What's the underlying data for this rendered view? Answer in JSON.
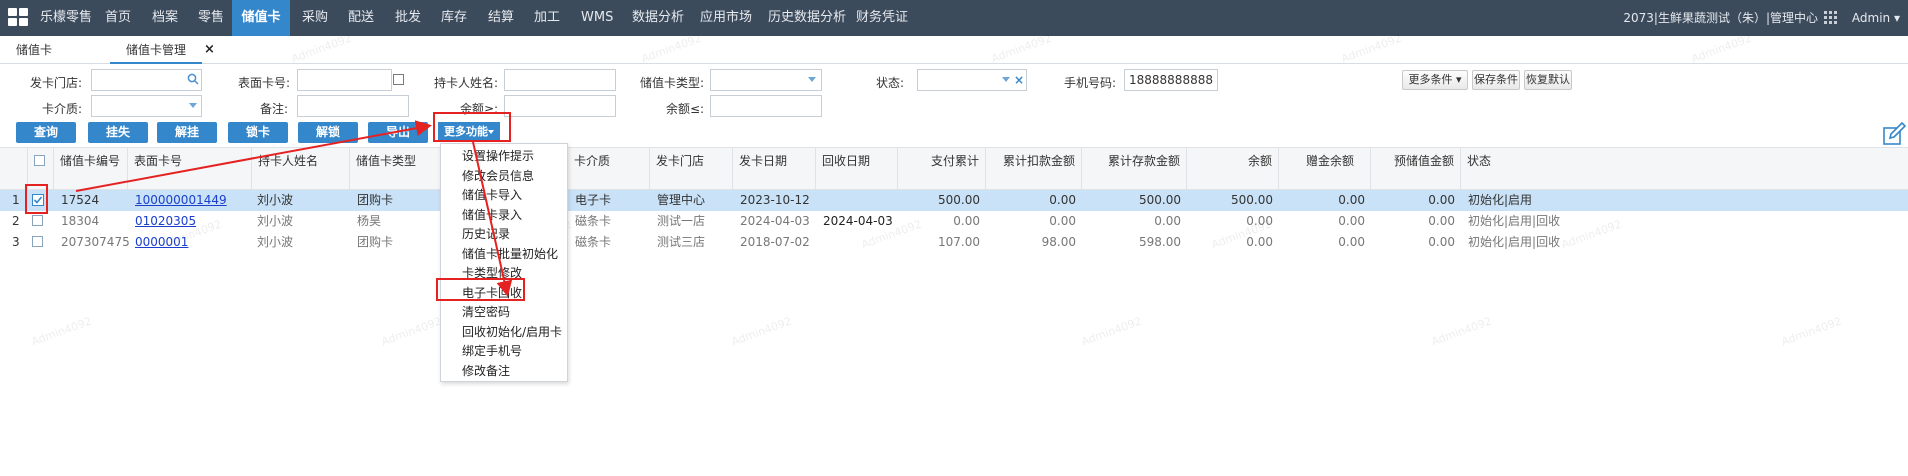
{
  "nav": {
    "brand": "乐檬零售",
    "items": [
      "首页",
      "档案",
      "零售",
      "储值卡",
      "采购",
      "配送",
      "批发",
      "库存",
      "结算",
      "加工",
      "WMS",
      "数据分析",
      "应用市场",
      "历史数据分析",
      "财务凭证"
    ],
    "active": "储值卡",
    "store_info": "2073|生鲜果蔬测试（朱）|管理中心",
    "user": "Admin"
  },
  "tabs": [
    "储值卡",
    "储值卡管理"
  ],
  "tab_close": "×",
  "form": {
    "issue_store_label": "发卡门店:",
    "face_card_no_label": "表面卡号:",
    "holder_name_label": "持卡人姓名:",
    "card_type_label": "储值卡类型:",
    "status_label": "状态:",
    "status_clear": "×",
    "phone_label": "手机号码:",
    "phone_value": "18888888888",
    "medium_label": "卡介质:",
    "remark_label": "备注:",
    "balance_ge_label": "余额≥:",
    "balance_le_label": "余额≤:",
    "more_conditions": "更多条件",
    "save_conditions": "保存条件",
    "restore_default": "恢复默认"
  },
  "buttons": {
    "query": "查询",
    "report_loss": "挂失",
    "cancel_loss": "解挂",
    "lock": "锁卡",
    "unlock": "解锁",
    "export": "导出",
    "more_functions": "更多功能"
  },
  "table": {
    "columns": [
      "储值卡编号",
      "表面卡号",
      "持卡人姓名",
      "储值卡类型",
      "卡介质",
      "发卡门店",
      "发卡日期",
      "回收日期",
      "支付累计",
      "累计扣款金额",
      "累计存款金额",
      "余额",
      "赠金余额",
      "预储值金额",
      "状态"
    ],
    "rows": [
      {
        "num": "1",
        "id": "17524",
        "face": "100000001449",
        "holder": "刘小波",
        "type": "团购卡",
        "medium": "电子卡",
        "store": "管理中心",
        "issue_date": "2023-10-12",
        "recycle_date": "",
        "pay_total": "500.00",
        "deduct_total": "0.00",
        "deposit_total": "500.00",
        "balance": "500.00",
        "gift_balance": "0.00",
        "prestore": "0.00",
        "status": "初始化|启用"
      },
      {
        "num": "2",
        "id": "18304",
        "face": "01020305",
        "holder": "刘小波",
        "type": "杨昊",
        "medium": "磁条卡",
        "store": "测试一店",
        "issue_date": "2024-04-03",
        "recycle_date": "2024-04-03",
        "pay_total": "0.00",
        "deduct_total": "0.00",
        "deposit_total": "0.00",
        "balance": "0.00",
        "gift_balance": "0.00",
        "prestore": "0.00",
        "status": "初始化|启用|回收"
      },
      {
        "num": "3",
        "id": "207307475",
        "face": "0000001",
        "holder": "刘小波",
        "type": "团购卡",
        "medium": "磁条卡",
        "store": "测试三店",
        "issue_date": "2018-07-02",
        "recycle_date": "",
        "pay_total": "107.00",
        "deduct_total": "98.00",
        "deposit_total": "598.00",
        "balance": "0.00",
        "gift_balance": "0.00",
        "prestore": "0.00",
        "status": "初始化|启用|回收"
      }
    ]
  },
  "menu": [
    "设置操作提示",
    "修改会员信息",
    "储值卡导入",
    "储值卡录入",
    "历史记录",
    "储值卡批量初始化",
    "卡类型修改",
    "电子卡回收",
    "清空密码",
    "回收初始化/启用卡",
    "绑定手机号",
    "修改备注"
  ],
  "watermark": "Admin4092",
  "colors": {
    "nav_bg": "#3c4b5c",
    "accent": "#3587cc",
    "highlight": "#e52222",
    "selected_row": "#c9e2f7"
  }
}
